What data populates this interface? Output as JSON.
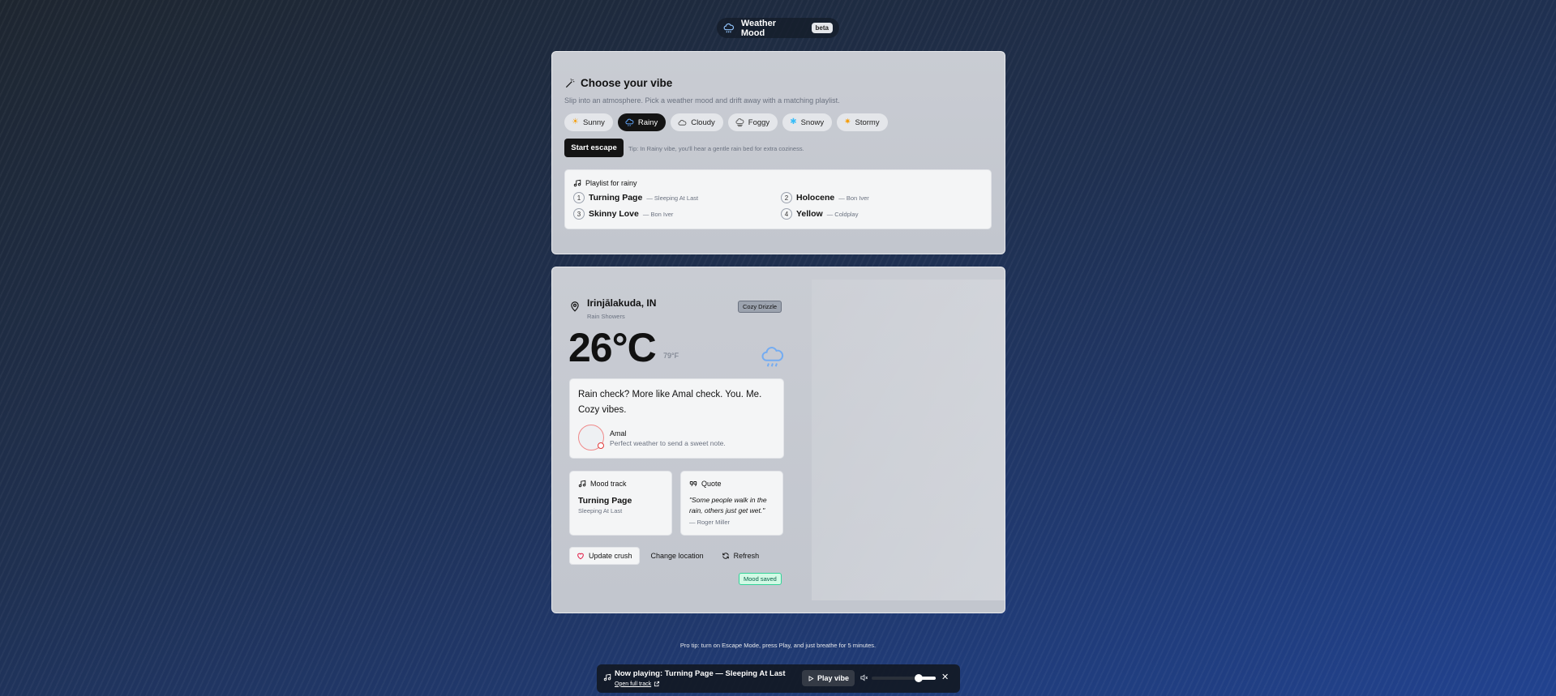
{
  "brand": {
    "name": "Weather Mood",
    "badge": "beta",
    "icon": "cloud-rain-icon"
  },
  "vibe": {
    "title": "Choose your vibe",
    "subtitle": "Slip into an atmosphere. Pick a weather mood and drift away with a matching playlist.",
    "moods": [
      {
        "label": "Sunny",
        "icon": "sun-icon",
        "active": false
      },
      {
        "label": "Rainy",
        "icon": "cloud-rain-icon",
        "active": true
      },
      {
        "label": "Cloudy",
        "icon": "cloud-icon",
        "active": false
      },
      {
        "label": "Foggy",
        "icon": "fog-icon",
        "active": false
      },
      {
        "label": "Snowy",
        "icon": "snowflake-icon",
        "active": false
      },
      {
        "label": "Stormy",
        "icon": "lightning-icon",
        "active": false
      }
    ],
    "start_label": "Start escape",
    "tip": "Tip: In Rainy vibe, you'll hear a gentle rain bed for extra coziness."
  },
  "playlist": {
    "heading": "Playlist for rainy",
    "tracks": [
      {
        "num": "1",
        "name": "Turning Page",
        "artist": "— Sleeping At Last"
      },
      {
        "num": "2",
        "name": "Holocene",
        "artist": "— Bon Iver"
      },
      {
        "num": "3",
        "name": "Skinny Love",
        "artist": "— Bon Iver"
      },
      {
        "num": "4",
        "name": "Yellow",
        "artist": "— Coldplay"
      }
    ]
  },
  "weather": {
    "city": "Irinjālakuda, IN",
    "condition": "Rain Showers",
    "mood_tag": "Cozy Drizzle",
    "temp_c": "26°C",
    "temp_f": "79°F"
  },
  "note": {
    "message": "Rain check? More like Amal check. You. Me. Cozy vibes.",
    "name": "Amal",
    "sub": "Perfect weather to send a sweet note."
  },
  "mood_track": {
    "heading": "Mood track",
    "title": "Turning Page",
    "artist": "Sleeping At Last"
  },
  "quote": {
    "heading": "Quote",
    "text": "\"Some people walk in the rain, others just get wet.\"",
    "author": "— Roger Miller"
  },
  "actions": {
    "update": "Update crush",
    "change": "Change location",
    "refresh": "Refresh",
    "saved": "Mood saved"
  },
  "footer": {
    "protip": "Pro tip: turn on Escape Mode, press Play, and just breathe for 5 minutes."
  },
  "player": {
    "now_playing": "Now playing: Turning Page — Sleeping At Last",
    "link": "Open full track",
    "play": "Play vibe",
    "volume": 0.75,
    "close": "✕"
  },
  "colors": {
    "accent": "#141414",
    "rain_icon": "#60a5fa",
    "saved_bg": "#d1fae5",
    "heart": "#e11d48"
  }
}
